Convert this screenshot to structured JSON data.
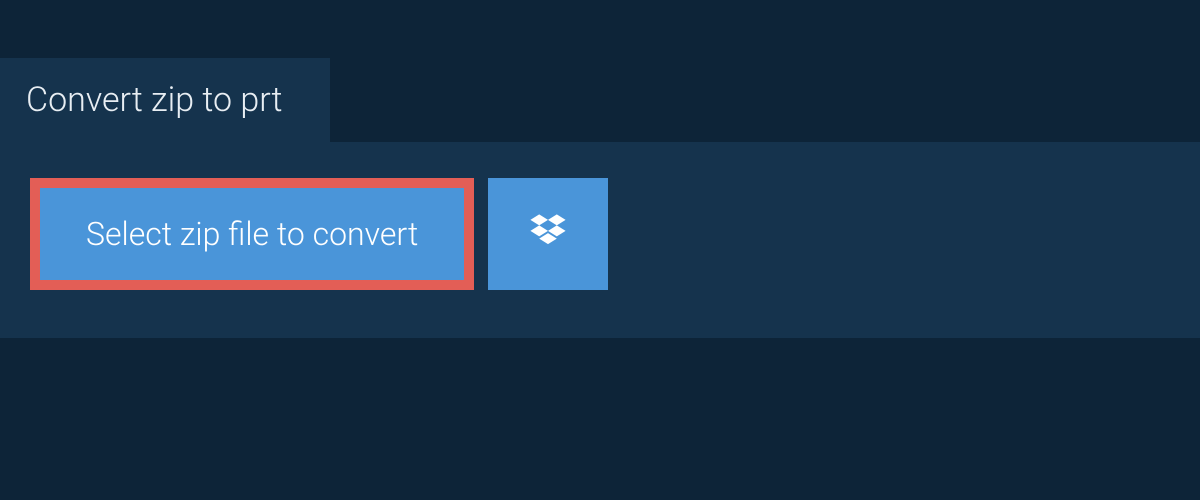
{
  "tab": {
    "title": "Convert zip to prt"
  },
  "actions": {
    "select_file_label": "Select zip file to convert"
  }
}
